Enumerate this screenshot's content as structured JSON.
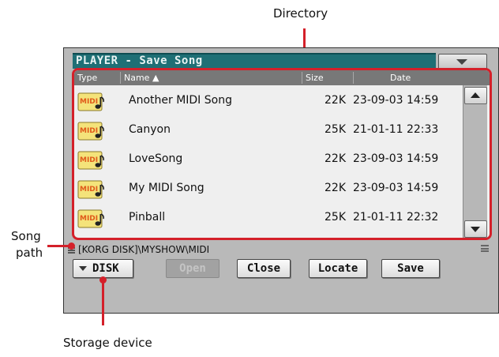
{
  "callouts": {
    "directory": "Directory",
    "song_path_line1": "Song",
    "song_path_line2": "path",
    "storage_device": "Storage device"
  },
  "window": {
    "title": "PLAYER - Save Song"
  },
  "columns": {
    "type": "Type",
    "name": "Name ▲",
    "size": "Size",
    "date": "Date"
  },
  "files": [
    {
      "icon": "midi-file-icon",
      "name": "Another MIDI Song",
      "size": "22K",
      "date": "23-09-03 14:59"
    },
    {
      "icon": "midi-file-icon",
      "name": "Canyon",
      "size": "25K",
      "date": "21-01-11 22:33"
    },
    {
      "icon": "midi-file-icon",
      "name": "LoveSong",
      "size": "22K",
      "date": "23-09-03 14:59"
    },
    {
      "icon": "midi-file-icon",
      "name": "My MIDI Song",
      "size": "22K",
      "date": "23-09-03 14:59"
    },
    {
      "icon": "midi-file-icon",
      "name": "Pinball",
      "size": "25K",
      "date": "21-01-11 22:32"
    }
  ],
  "midi_label": "MIDI",
  "path": "[KORG DISK]\\MYSHOW\\MIDI",
  "buttons": {
    "disk": "DISK",
    "open": "Open",
    "close": "Close",
    "locate": "Locate",
    "save": "Save"
  },
  "colors": {
    "annotation_red": "#d4202a",
    "title_bar": "#1f6f75",
    "header_bar": "#787878"
  }
}
